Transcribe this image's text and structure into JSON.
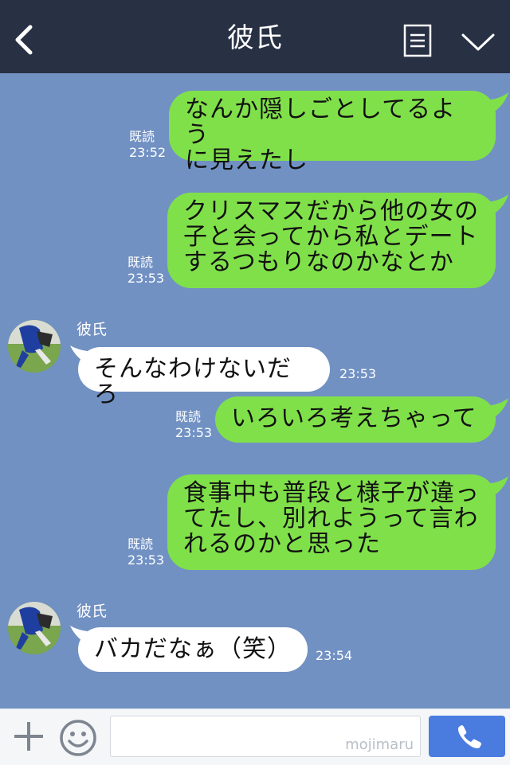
{
  "header": {
    "title": "彼氏",
    "back_icon": "chevron-left-icon",
    "menu_icon": "menu-icon",
    "collapse_icon": "chevron-down-icon"
  },
  "colors": {
    "header_bg": "#283044",
    "chat_bg": "#7191c3",
    "my_bubble": "#80e04a",
    "their_bubble": "#ffffff",
    "send_button": "#4a7ce0"
  },
  "messages": [
    {
      "from": "me",
      "lines": [
        "なんか隠しごとしてるよう",
        "に見えたし"
      ],
      "read": "既読",
      "time": "23:52"
    },
    {
      "from": "me",
      "lines": [
        "クリスマスだから他の女の",
        "子と会ってから私とデート",
        "するつもりなのかなとか"
      ],
      "read": "既読",
      "time": "23:53"
    },
    {
      "from": "them",
      "sender": "彼氏",
      "lines": [
        "そんなわけないだろ"
      ],
      "time": "23:53"
    },
    {
      "from": "me",
      "lines": [
        "いろいろ考えちゃって"
      ],
      "read": "既読",
      "time": "23:53"
    },
    {
      "from": "me",
      "lines": [
        "食事中も普段と様子が違っ",
        "てたし、別れようって言わ",
        "れるのかと思った"
      ],
      "read": "既読",
      "time": "23:53"
    },
    {
      "from": "them",
      "sender": "彼氏",
      "lines": [
        "バカだなぁ（笑）"
      ],
      "time": "23:54"
    }
  ],
  "input": {
    "placeholder": "",
    "watermark": "mojimaru",
    "plus_icon": "plus-icon",
    "sticker_icon": "smiley-icon",
    "call_icon": "phone-icon"
  }
}
